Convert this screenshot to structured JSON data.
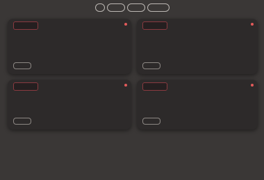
{
  "filters": [
    {
      "label": ""
    },
    {
      "label": ""
    },
    {
      "label": ""
    },
    {
      "label": ""
    }
  ],
  "cards": [
    {
      "badge": "",
      "text": "",
      "read_more": ""
    },
    {
      "badge": "",
      "text": "",
      "read_more": ""
    },
    {
      "badge": "",
      "text": "",
      "read_more": ""
    },
    {
      "badge": "",
      "text": "",
      "read_more": ""
    }
  ],
  "colors": {
    "background": "#3a3736",
    "card": "#2d2a2a",
    "badge_border": "#8a3a40",
    "dot": "#e25a5a"
  }
}
